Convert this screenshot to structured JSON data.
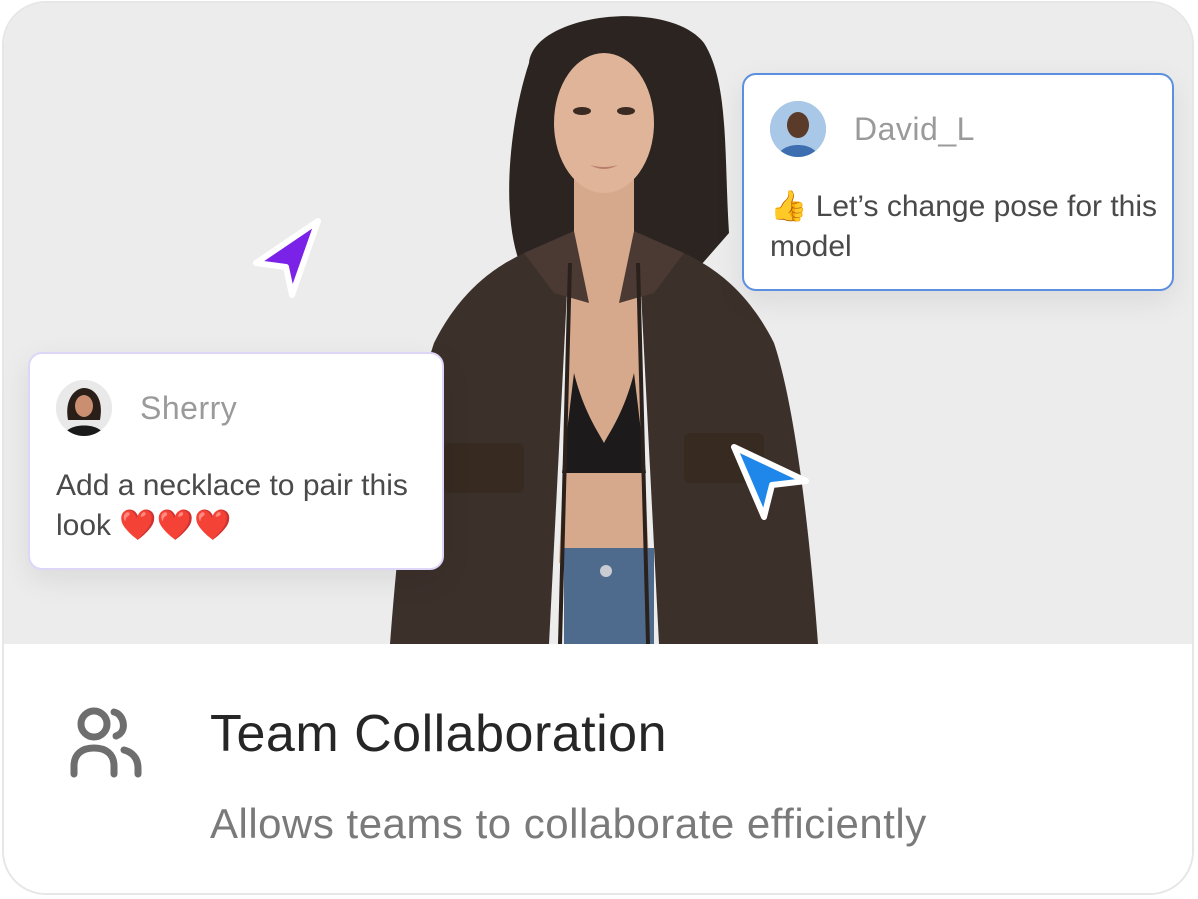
{
  "comments": {
    "david": {
      "author": "David_L",
      "message": "👍 Let’s change pose for this model"
    },
    "sherry": {
      "author": "Sherry",
      "message": "Add a necklace to pair this look ❤️❤️❤️"
    }
  },
  "feature": {
    "title": "Team Collaboration",
    "description": "Allows teams to collaborate efficiently",
    "icon": "team-users-icon"
  },
  "cursors": [
    {
      "name": "purple-pointer-icon",
      "color": "#7b22e8"
    },
    {
      "name": "blue-pointer-icon",
      "color": "#1f87ea"
    }
  ],
  "colors": {
    "hero_background": "#ececec",
    "active_comment_border": "#5b8fe0",
    "comment_border": "#ddd6f8",
    "title_text": "#262626",
    "body_text": "#7a7a7a"
  }
}
